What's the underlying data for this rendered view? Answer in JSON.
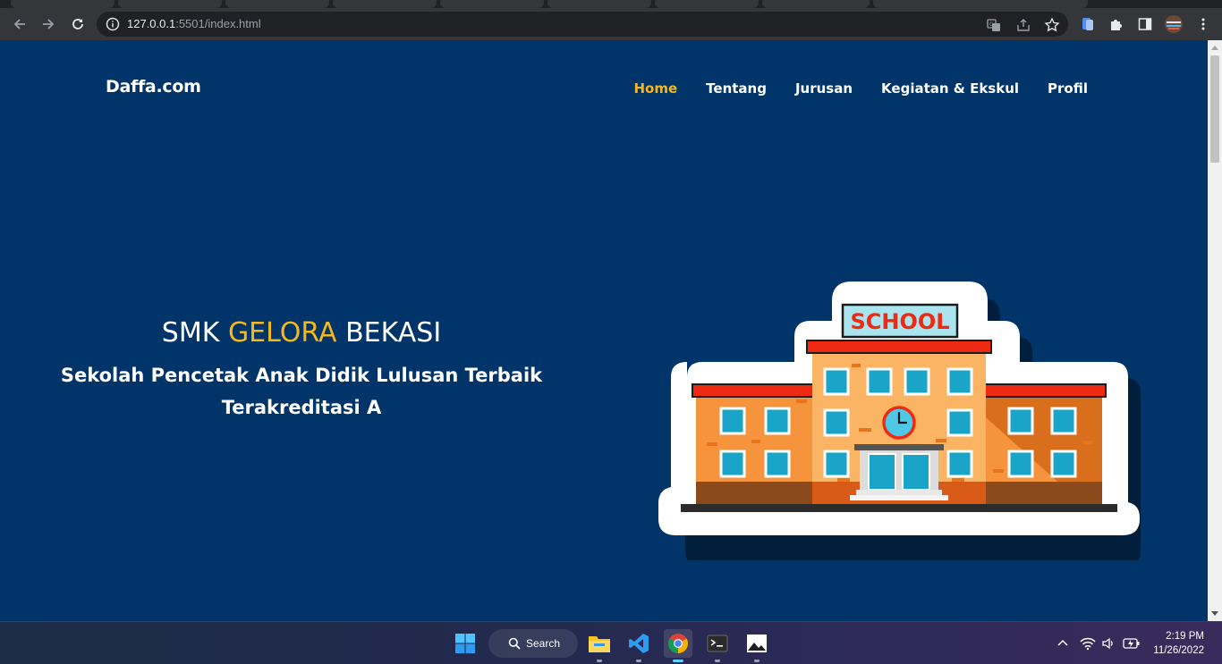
{
  "browser": {
    "url_host": "127.0.0.1",
    "url_rest": ":5501/index.html"
  },
  "site": {
    "brand": "Daffa.com",
    "nav": [
      {
        "label": "Home",
        "active": true
      },
      {
        "label": "Tentang",
        "active": false
      },
      {
        "label": "Jurusan",
        "active": false
      },
      {
        "label": "Kegiatan & Ekskul",
        "active": false
      },
      {
        "label": "Profil",
        "active": false
      }
    ],
    "hero": {
      "title_prefix": "SMK ",
      "title_accent": "GELORA",
      "title_suffix": " BEKASI",
      "subtitle_line1": "Sekolah Pencetak Anak Didik Lulusan Terbaik",
      "subtitle_line2": "Terakreditasi A"
    },
    "illustration": {
      "sign_text": "SCHOOL"
    },
    "colors": {
      "background": "#013468",
      "accent": "#f6b81c",
      "text": "#ffffff"
    }
  },
  "taskbar": {
    "search_label": "Search",
    "time": "2:19 PM",
    "date": "11/26/2022"
  }
}
